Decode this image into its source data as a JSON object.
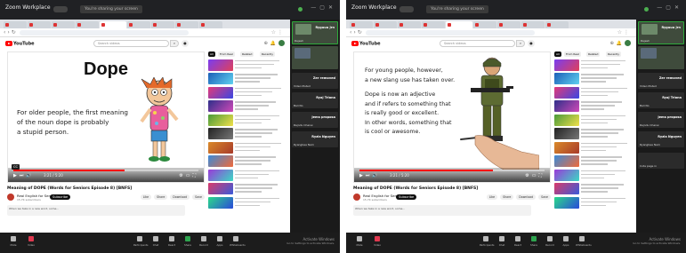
{
  "left": {
    "topbar": {
      "app": "Zoom Workplace",
      "share_text": "You're sharing your screen"
    },
    "video": {
      "title": "Dope",
      "caption_lines": [
        "For older people, the first meaning",
        "of the noun dope is probably",
        "a stupid person."
      ]
    },
    "panel": [
      {
        "name": "Rajesh",
        "big": "Ryguuu Jrn"
      },
      {
        "name": "",
        "big": ""
      },
      {
        "name": "Video Muted",
        "big": "Zer removed"
      },
      {
        "name": "Bali No",
        "big": "Ryaj Triona"
      },
      {
        "name": "Rajndu Chanw",
        "big": "Jems proposa"
      },
      {
        "name": "Ryangbee Nam",
        "big": "Ryzia Nguyen"
      }
    ]
  },
  "right": {
    "topbar": {
      "app": "Zoom Workplace",
      "share_text": "You're sharing your screen"
    },
    "video": {
      "caption_lines": [
        "For young people, however,",
        "a new slang use has taken over.",
        "",
        "Dope is now an adjective",
        "and if refers to something that",
        "is really good or excellent.",
        "In other words, something that",
        "is cool or awesome."
      ]
    },
    "panel": [
      {
        "name": "Rajesh",
        "big": "Ryguuu Jrn"
      },
      {
        "name": "",
        "big": ""
      },
      {
        "name": "Video Muted",
        "big": "Zer removed"
      },
      {
        "name": "Bali No",
        "big": "Ryaj Triona"
      },
      {
        "name": "Rajndu Chanw",
        "big": "Jems proposa"
      },
      {
        "name": "Ryangbee Nam",
        "big": "Ryzia Nguyen"
      },
      {
        "name": "Cota page in",
        "big": ""
      }
    ]
  },
  "common": {
    "youtube": {
      "logo": "YouTube",
      "search_placeholder": "Search videos"
    },
    "video_meta": {
      "title": "Meaning of DOPE (Words for Seniors Episode 8) [BNFS]",
      "channel": "Real English for Seniors",
      "subs": "15.7K subscribers",
      "subscribe": "Subscribe",
      "actions": [
        "Like",
        "Share",
        "Download",
        "Save"
      ],
      "description": "When we take in a new word, some..."
    },
    "chips": [
      "All",
      "From Real",
      "Related",
      "Recently"
    ],
    "player_time": "3:21 / 5:20",
    "toolbar": [
      {
        "label": "Mute",
        "kind": "normal"
      },
      {
        "label": "Video",
        "kind": "red"
      },
      {
        "label": "Participants",
        "kind": "normal"
      },
      {
        "label": "Chat",
        "kind": "normal"
      },
      {
        "label": "React",
        "kind": "normal"
      },
      {
        "label": "Share",
        "kind": "green"
      },
      {
        "label": "Record",
        "kind": "normal"
      },
      {
        "label": "Apps",
        "kind": "normal"
      },
      {
        "label": "Whiteboards",
        "kind": "normal"
      }
    ],
    "windows_notice": {
      "line1": "Activate Windows",
      "line2": "Go to Settings to activate Windows."
    },
    "colors": {
      "youtube_red": "#ff0000",
      "zoom_green": "#2ea44f",
      "zoom_bg": "#1f1f1f"
    }
  }
}
